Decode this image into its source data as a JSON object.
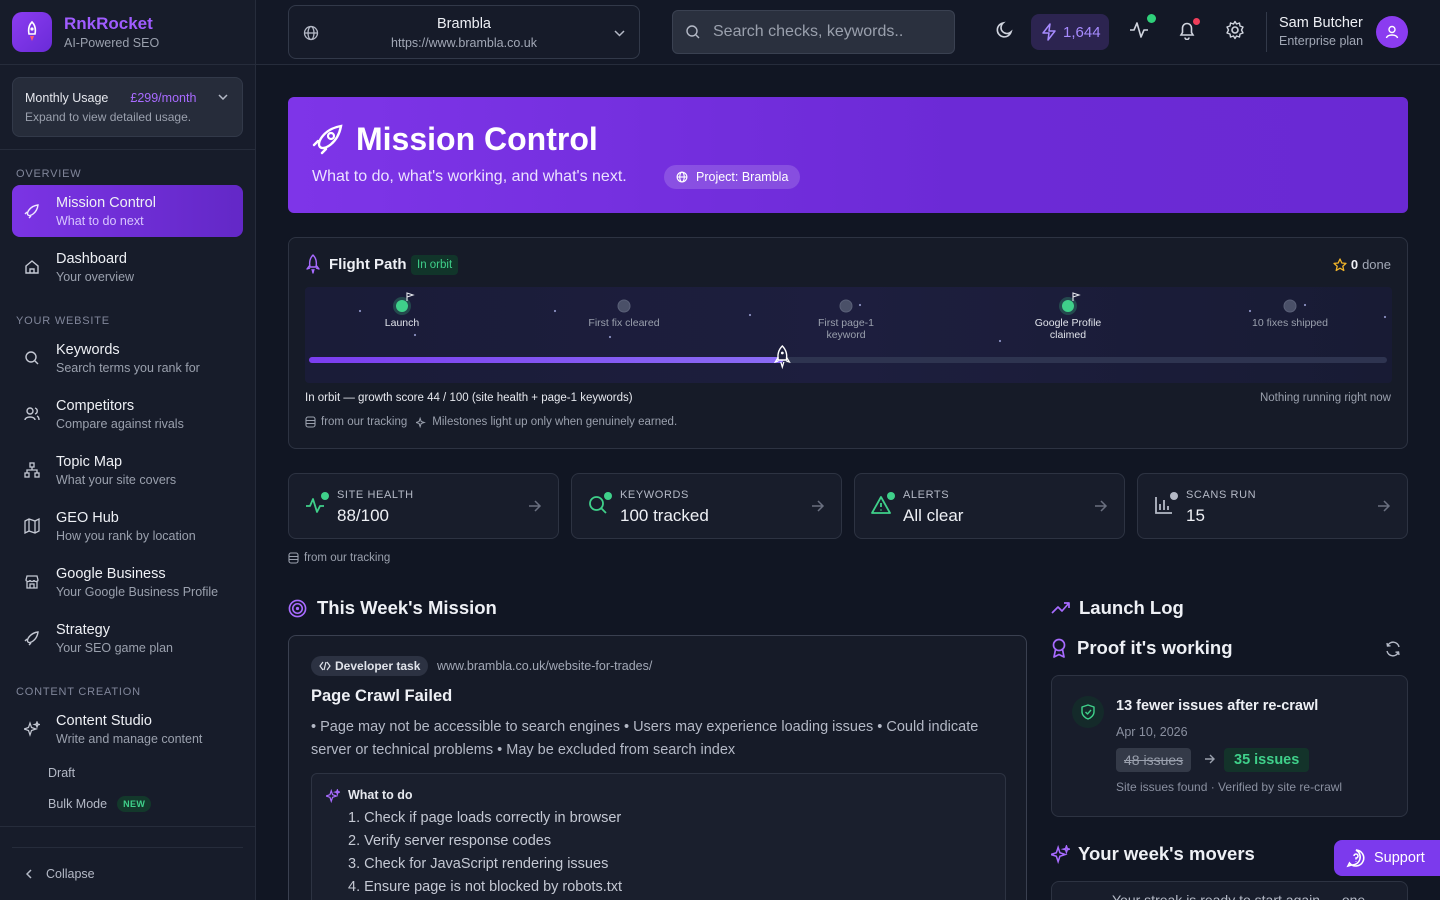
{
  "brand": {
    "name": "RnkRocket",
    "tagline": "AI-Powered SEO"
  },
  "usage": {
    "title": "Monthly Usage",
    "price": "£299/month",
    "hint": "Expand to view detailed usage."
  },
  "nav": {
    "sections": {
      "overview": "Overview",
      "website": "Your Website",
      "content": "Content Creation"
    },
    "items": [
      {
        "title": "Mission Control",
        "sub": "What to do next"
      },
      {
        "title": "Dashboard",
        "sub": "Your overview"
      },
      {
        "title": "Keywords",
        "sub": "Search terms you rank for"
      },
      {
        "title": "Competitors",
        "sub": "Compare against rivals"
      },
      {
        "title": "Topic Map",
        "sub": "What your site covers"
      },
      {
        "title": "GEO Hub",
        "sub": "How you rank by location"
      },
      {
        "title": "Google Business",
        "sub": "Your Google Business Profile"
      },
      {
        "title": "Strategy",
        "sub": "Your SEO game plan"
      },
      {
        "title": "Content Studio",
        "sub": "Write and manage content"
      }
    ],
    "sub_items": {
      "draft": "Draft",
      "bulk": "Bulk Mode",
      "bulk_badge": "NEW"
    },
    "collapse": "Collapse"
  },
  "header": {
    "site_name": "Brambla",
    "site_url": "https://www.brambla.co.uk",
    "search_placeholder": "Search checks, keywords..",
    "credits": "1,644",
    "user_name": "Sam Butcher",
    "user_plan": "Enterprise plan"
  },
  "hero": {
    "title": "Mission Control",
    "subtitle": "What to do, what's working, and what's next.",
    "project": "Project: Brambla"
  },
  "flight": {
    "title": "Flight Path",
    "badge": "In orbit",
    "done_count": "0",
    "done_label": "done",
    "progress": 0.44,
    "milestones": [
      {
        "label1": "Launch",
        "label2": "",
        "achieved": true
      },
      {
        "label1": "First fix cleared",
        "label2": "",
        "achieved": false
      },
      {
        "label1": "First page-1",
        "label2": "keyword",
        "achieved": false
      },
      {
        "label1": "Google Profile",
        "label2": "claimed",
        "achieved": true
      },
      {
        "label1": "10 fixes shipped",
        "label2": "",
        "achieved": false
      }
    ],
    "status": "In orbit — growth score 44 / 100 (site health + page-1 keywords)",
    "running": "Nothing running right now",
    "source": "from our tracking",
    "note": "Milestones light up only when genuinely earned."
  },
  "stats": [
    {
      "label": "SITE HEALTH",
      "value": "88/100"
    },
    {
      "label": "KEYWORDS",
      "value": "100 tracked"
    },
    {
      "label": "ALERTS",
      "value": "All clear"
    },
    {
      "label": "SCANS RUN",
      "value": "15"
    }
  ],
  "stats_source": "from our tracking",
  "mission": {
    "title": "This Week's Mission",
    "tag": "Developer task",
    "url": "www.brambla.co.uk/website-for-trades/",
    "task_title": "Page Crawl Failed",
    "description": "• Page may not be accessible to search engines • Users may experience loading issues • Could indicate server or technical problems • May be excluded from search index",
    "todo_title": "What to do",
    "steps": [
      "1. Check if page loads correctly in browser",
      "2. Verify server response codes",
      "3. Check for JavaScript rendering issues",
      "4. Ensure page is not blocked by robots.txt"
    ]
  },
  "launch_log": {
    "title": "Launch Log",
    "proof_title": "Proof it's working",
    "card_title": "13 fewer issues after re-crawl",
    "date": "Apr 10, 2026",
    "old_value": "48 issues",
    "new_value": "35 issues",
    "foot": "Site issues found · Verified by site re-crawl"
  },
  "movers": {
    "title": "Your week's movers",
    "text": "Your streak is ready to start again — one"
  },
  "support": "Support",
  "colors": {
    "accent": "#7c3aed",
    "success": "#3fd08a",
    "alert": "#f03e5a"
  }
}
